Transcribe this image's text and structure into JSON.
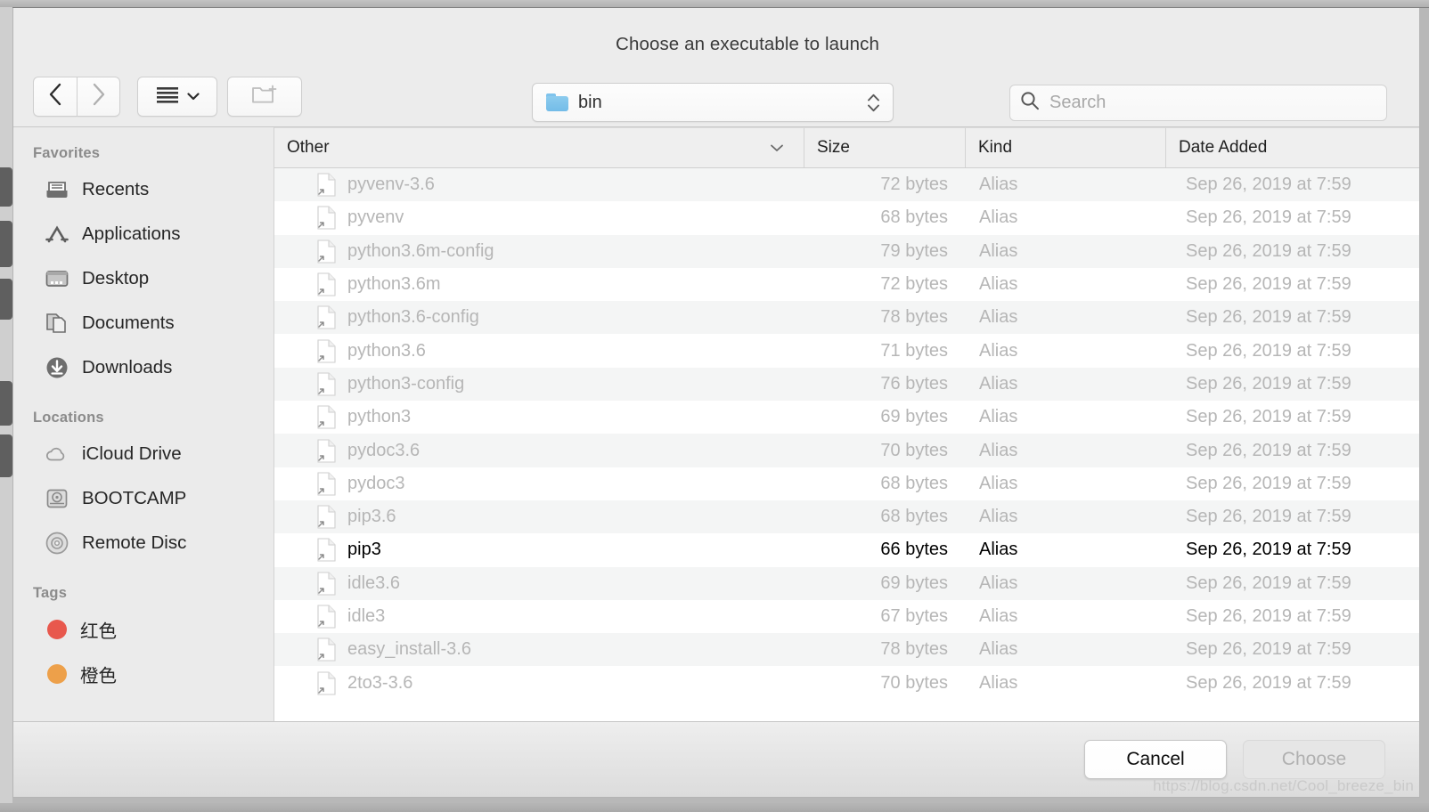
{
  "dialog": {
    "title": "Choose an executable to launch"
  },
  "toolbar": {
    "back_icon": "chevron-left-icon",
    "forward_icon": "chevron-right-icon",
    "view_icon": "list-view-icon",
    "view_chevron_icon": "chevron-down-icon",
    "new_folder_icon": "new-folder-icon",
    "path_label": "bin",
    "path_folder_icon": "folder-icon",
    "stepper_icon": "up-down-stepper-icon",
    "search_icon": "search-icon",
    "search_placeholder": "Search",
    "search_value": ""
  },
  "sidebar": {
    "sections": [
      {
        "header": "Favorites",
        "items": [
          {
            "label": "Recents",
            "icon": "recents-icon"
          },
          {
            "label": "Applications",
            "icon": "applications-icon"
          },
          {
            "label": "Desktop",
            "icon": "desktop-icon"
          },
          {
            "label": "Documents",
            "icon": "documents-icon"
          },
          {
            "label": "Downloads",
            "icon": "downloads-icon"
          }
        ]
      },
      {
        "header": "Locations",
        "items": [
          {
            "label": "iCloud Drive",
            "icon": "icloud-icon"
          },
          {
            "label": "BOOTCAMP",
            "icon": "hard-disk-icon"
          },
          {
            "label": "Remote Disc",
            "icon": "optical-disc-icon"
          }
        ]
      },
      {
        "header": "Tags",
        "items": [
          {
            "label": "红色",
            "icon": "tag-dot-icon",
            "color": "#e8584d"
          },
          {
            "label": "橙色",
            "icon": "tag-dot-icon",
            "color": "#eda04a"
          }
        ]
      }
    ]
  },
  "file_list": {
    "columns": [
      {
        "key": "name",
        "label": "Other",
        "sorted": true,
        "sort_icon": "chevron-down-icon"
      },
      {
        "key": "size",
        "label": "Size",
        "sorted": false
      },
      {
        "key": "kind",
        "label": "Kind",
        "sorted": false
      },
      {
        "key": "date",
        "label": "Date Added",
        "sorted": false
      }
    ],
    "rows": [
      {
        "name": "pyvenv-3.6",
        "size": "72 bytes",
        "kind": "Alias",
        "date": "Sep 26, 2019 at 7:59",
        "enabled": false
      },
      {
        "name": "pyvenv",
        "size": "68 bytes",
        "kind": "Alias",
        "date": "Sep 26, 2019 at 7:59",
        "enabled": false
      },
      {
        "name": "python3.6m-config",
        "size": "79 bytes",
        "kind": "Alias",
        "date": "Sep 26, 2019 at 7:59",
        "enabled": false
      },
      {
        "name": "python3.6m",
        "size": "72 bytes",
        "kind": "Alias",
        "date": "Sep 26, 2019 at 7:59",
        "enabled": false
      },
      {
        "name": "python3.6-config",
        "size": "78 bytes",
        "kind": "Alias",
        "date": "Sep 26, 2019 at 7:59",
        "enabled": false
      },
      {
        "name": "python3.6",
        "size": "71 bytes",
        "kind": "Alias",
        "date": "Sep 26, 2019 at 7:59",
        "enabled": false
      },
      {
        "name": "python3-config",
        "size": "76 bytes",
        "kind": "Alias",
        "date": "Sep 26, 2019 at 7:59",
        "enabled": false
      },
      {
        "name": "python3",
        "size": "69 bytes",
        "kind": "Alias",
        "date": "Sep 26, 2019 at 7:59",
        "enabled": false
      },
      {
        "name": "pydoc3.6",
        "size": "70 bytes",
        "kind": "Alias",
        "date": "Sep 26, 2019 at 7:59",
        "enabled": false
      },
      {
        "name": "pydoc3",
        "size": "68 bytes",
        "kind": "Alias",
        "date": "Sep 26, 2019 at 7:59",
        "enabled": false
      },
      {
        "name": "pip3.6",
        "size": "68 bytes",
        "kind": "Alias",
        "date": "Sep 26, 2019 at 7:59",
        "enabled": false
      },
      {
        "name": "pip3",
        "size": "66 bytes",
        "kind": "Alias",
        "date": "Sep 26, 2019 at 7:59",
        "enabled": true
      },
      {
        "name": "idle3.6",
        "size": "69 bytes",
        "kind": "Alias",
        "date": "Sep 26, 2019 at 7:59",
        "enabled": false
      },
      {
        "name": "idle3",
        "size": "67 bytes",
        "kind": "Alias",
        "date": "Sep 26, 2019 at 7:59",
        "enabled": false
      },
      {
        "name": "easy_install-3.6",
        "size": "78 bytes",
        "kind": "Alias",
        "date": "Sep 26, 2019 at 7:59",
        "enabled": false
      },
      {
        "name": "2to3-3.6",
        "size": "70 bytes",
        "kind": "Alias",
        "date": "Sep 26, 2019 at 7:59",
        "enabled": false
      }
    ]
  },
  "footer": {
    "cancel_label": "Cancel",
    "choose_label": "Choose",
    "choose_disabled": true
  },
  "watermark": "https://blog.csdn.net/Cool_breeze_bin"
}
